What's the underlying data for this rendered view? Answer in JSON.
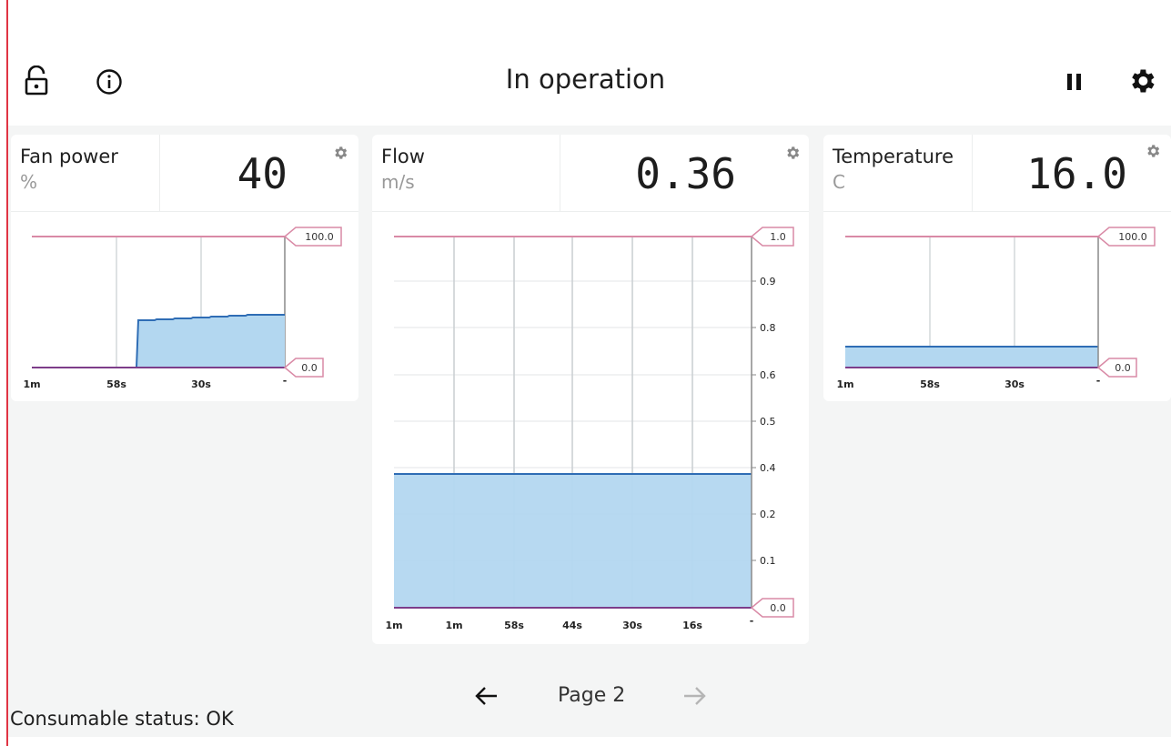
{
  "header": {
    "title": "In operation",
    "lock_icon": "unlock-icon",
    "info_icon": "info-icon",
    "pause_icon": "pause-icon",
    "settings_icon": "gear-icon"
  },
  "colors": {
    "fill": "#b3d7f0",
    "line": "#2f6db5",
    "limit": "#d98aa6",
    "baseline": "#7d3d8a"
  },
  "cards": [
    {
      "label": "Fan power",
      "unit": "%",
      "value": "40",
      "upper_limit": "100.0",
      "lower_limit": "0.0",
      "x_ticks": [
        "1m",
        "58s",
        "30s",
        "-"
      ],
      "y_ticks": []
    },
    {
      "label": "Flow",
      "unit": "m/s",
      "value": "0.36",
      "upper_limit": "1.0",
      "lower_limit": "0.0",
      "x_ticks": [
        "1m",
        "1m",
        "58s",
        "44s",
        "30s",
        "16s",
        "-"
      ],
      "y_ticks": [
        "0.9",
        "0.8",
        "0.6",
        "0.5",
        "0.4",
        "0.2",
        "0.1"
      ]
    },
    {
      "label": "Temperature",
      "unit": "C",
      "value": "16.0",
      "upper_limit": "100.0",
      "lower_limit": "0.0",
      "x_ticks": [
        "1m",
        "58s",
        "30s",
        "-"
      ],
      "y_ticks": []
    }
  ],
  "chart_data": [
    {
      "type": "area",
      "title": "Fan power",
      "ylabel": "%",
      "ylim": [
        0,
        100
      ],
      "x": [
        "1m",
        "58s",
        "30s",
        "-"
      ],
      "series": [
        {
          "values": [
            0,
            0,
            0,
            40
          ]
        }
      ]
    },
    {
      "type": "area",
      "title": "Flow",
      "ylabel": "m/s",
      "ylim": [
        0,
        1.0
      ],
      "x": [
        "1m",
        "1m",
        "58s",
        "44s",
        "30s",
        "16s",
        "-"
      ],
      "series": [
        {
          "values": [
            0.36,
            0.36,
            0.36,
            0.36,
            0.36,
            0.36,
            0.36
          ]
        }
      ]
    },
    {
      "type": "area",
      "title": "Temperature",
      "ylabel": "C",
      "ylim": [
        0,
        100
      ],
      "x": [
        "1m",
        "58s",
        "30s",
        "-"
      ],
      "series": [
        {
          "values": [
            16.0,
            16.0,
            16.0,
            16.0
          ]
        }
      ]
    }
  ],
  "pager": {
    "label": "Page 2",
    "prev_icon": "arrow-left-icon",
    "next_icon": "arrow-right-icon"
  },
  "status": {
    "text": "Consumable status: OK"
  }
}
